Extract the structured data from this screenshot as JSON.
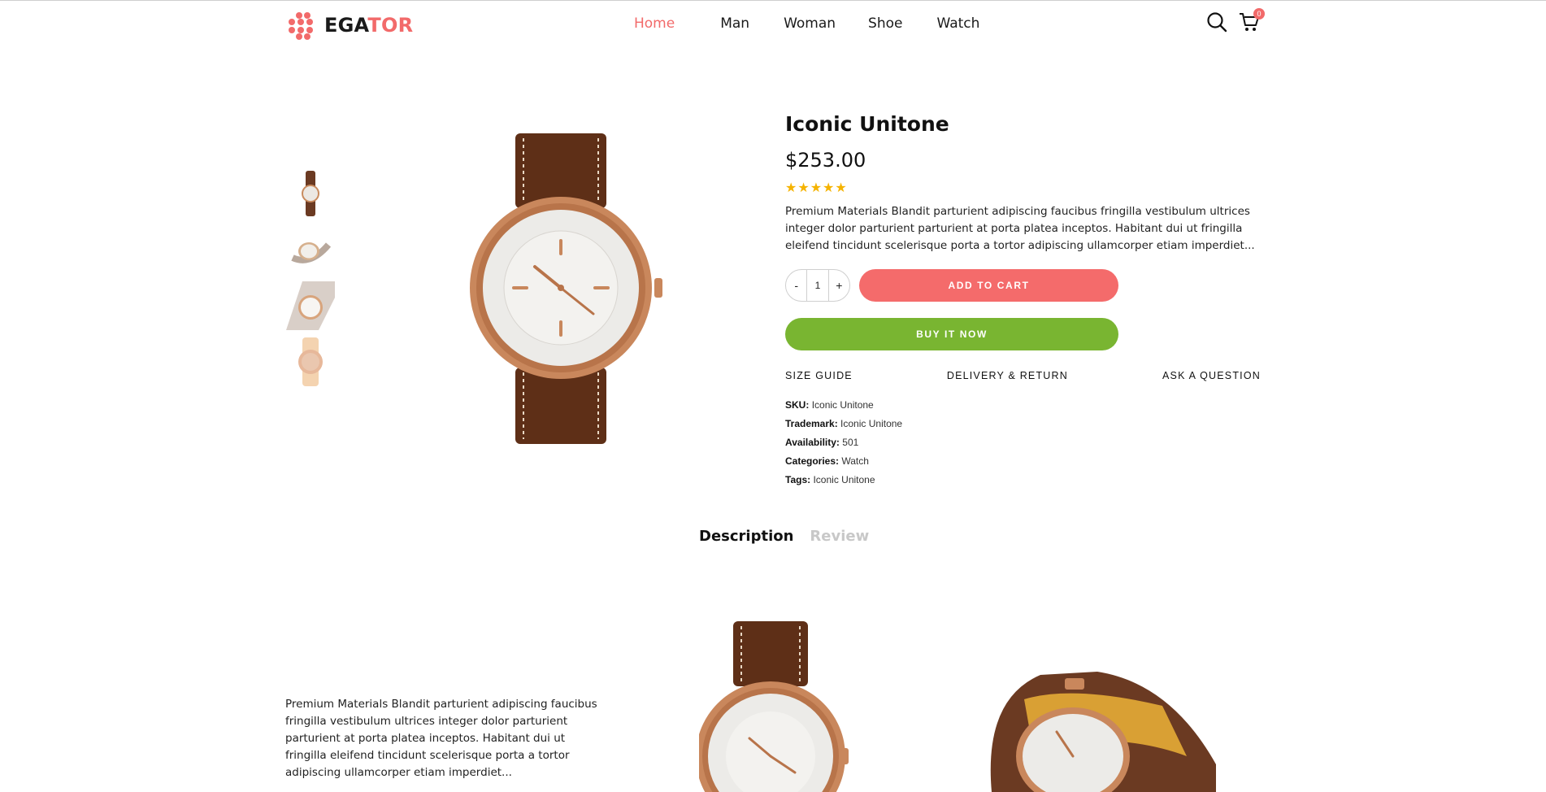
{
  "header": {
    "logo": {
      "part1": "EGA",
      "part2": "TOR"
    },
    "nav": [
      "Home",
      "Man",
      "Woman",
      "Shoe",
      "Watch"
    ],
    "active_nav": "Home",
    "cart_count": "0",
    "icons": [
      "search-icon",
      "cart-icon"
    ]
  },
  "product": {
    "title": "Iconic Unitone",
    "price": "$253.00",
    "rating": 5,
    "stars": "★★★★★",
    "description": "Premium Materials Blandit parturient adipiscing faucibus fringilla vestibulum ultrices integer dolor parturient parturient at porta platea inceptos. Habitant dui ut fringilla eleifend tincidunt scelerisque porta a tortor adipiscing ullamcorper etiam imperdiet...",
    "quantity": {
      "minus": "-",
      "value": "1",
      "plus": "+"
    },
    "add_to_cart": "ADD TO CART",
    "buy_now": "BUY IT NOW",
    "links": {
      "size_guide": "SIZE GUIDE",
      "delivery": "DELIVERY & RETURN",
      "ask": "ASK A QUESTION"
    },
    "meta": {
      "sku_label": "SKU:",
      "sku": "Iconic Unitone",
      "trademark_label": "Trademark:",
      "trademark": "Iconic Unitone",
      "availability_label": "Availability:",
      "availability": "501",
      "categories_label": "Categories:",
      "categories": "Watch",
      "tags_label": "Tags:",
      "tags": "Iconic Unitone"
    }
  },
  "tabs": {
    "description": "Description",
    "review": "Review"
  },
  "long_description": "Premium Materials Blandit parturient adipiscing faucibus fringilla vestibulum ultrices integer dolor parturient parturient at porta platea inceptos. Habitant dui ut fringilla eleifend tincidunt scelerisque porta a tortor adipiscing ullamcorper etiam imperdiet...",
  "colors": {
    "accent": "#f26a6a",
    "add_to_cart": "#f46b6b",
    "buy_now": "#79b531",
    "star": "#f5b300"
  }
}
